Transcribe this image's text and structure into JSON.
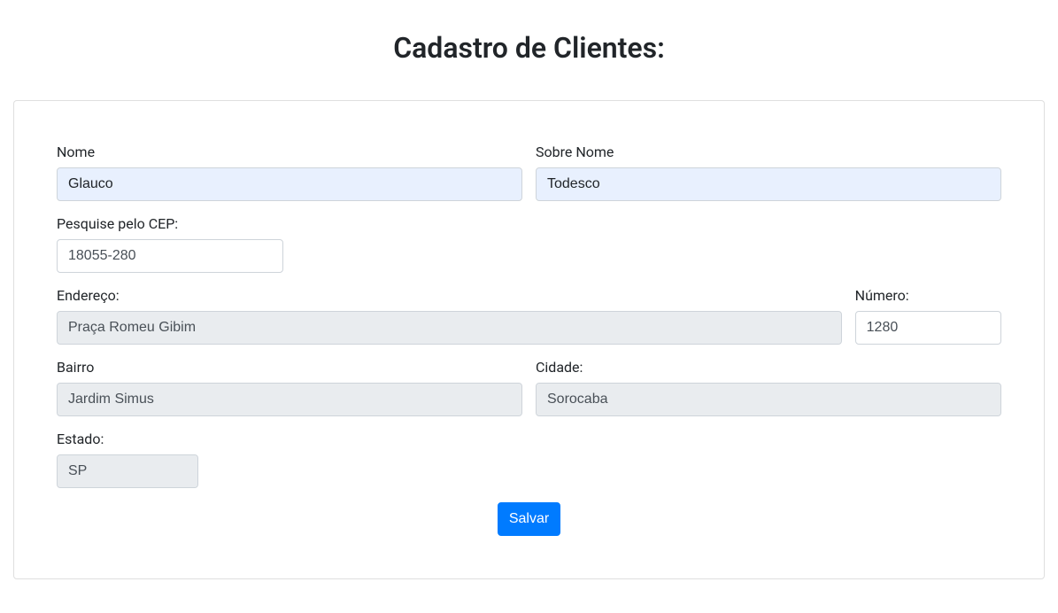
{
  "page": {
    "title": "Cadastro de Clientes:"
  },
  "form": {
    "nome": {
      "label": "Nome",
      "value": "Glauco"
    },
    "sobrenome": {
      "label": "Sobre Nome",
      "value": "Todesco"
    },
    "cep": {
      "label": "Pesquise pelo CEP:",
      "value": "18055-280"
    },
    "endereco": {
      "label": "Endereço:",
      "value": "Praça Romeu Gibim"
    },
    "numero": {
      "label": "Número:",
      "value": "1280"
    },
    "bairro": {
      "label": "Bairro",
      "value": "Jardim Simus"
    },
    "cidade": {
      "label": "Cidade:",
      "value": "Sorocaba"
    },
    "estado": {
      "label": "Estado:",
      "value": "SP"
    },
    "submit_label": "Salvar"
  }
}
